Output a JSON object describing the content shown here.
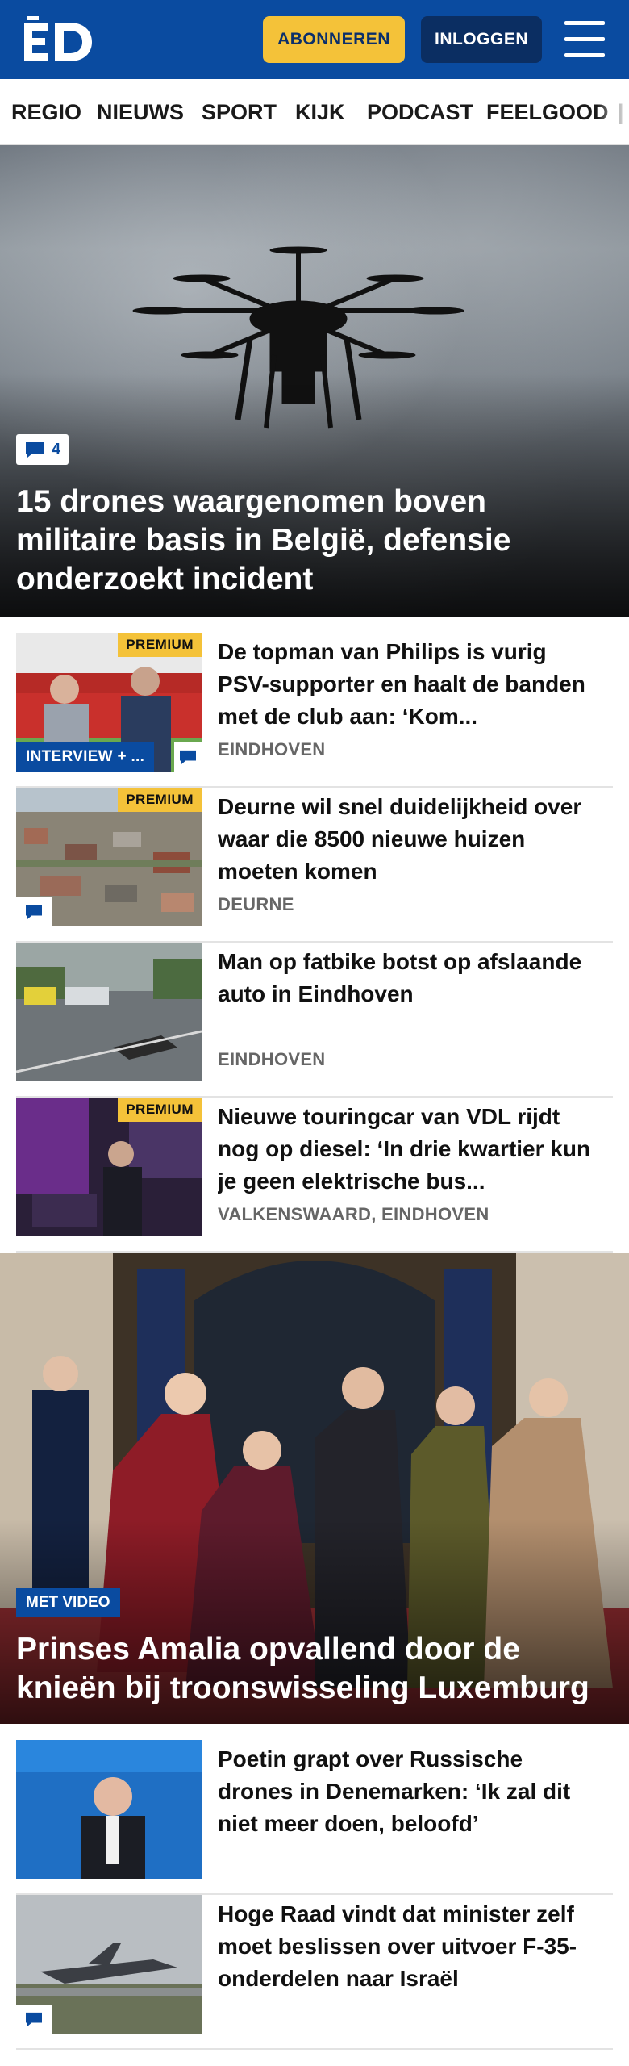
{
  "header": {
    "logo_text": "ED",
    "subscribe_label": "ABONNEREN",
    "login_label": "INLOGGEN"
  },
  "nav": {
    "items": [
      "REGIO",
      "NIEUWS",
      "SPORT",
      "KIJK",
      "PODCAST",
      "FEELGOOD"
    ]
  },
  "hero": {
    "comment_count": "4",
    "title": "15 drones waargenomen boven militaire basis in België, defensie onderzoekt incident"
  },
  "articles": [
    {
      "title": "De topman van Philips is vurig PSV-supporter en haalt de banden met de club aan: ‘Kom...",
      "location": "EINDHOVEN",
      "premium": "PREMIUM",
      "tag": "INTERVIEW + ..."
    },
    {
      "title": "Deurne wil snel duidelijkheid over waar die 8500 nieuwe huizen moeten komen",
      "location": "DEURNE",
      "premium": "PREMIUM"
    },
    {
      "title": "Man op fatbike botst op afslaande auto in Eindhoven",
      "location": "EINDHOVEN"
    },
    {
      "title": "Nieuwe touringcar van VDL rijdt nog op diesel: ‘In drie kwartier kun je geen elektrische bus...",
      "location": "VALKENSWAARD, EINDHOVEN",
      "premium": "PREMIUM"
    }
  ],
  "hero2": {
    "tag": "MET VIDEO",
    "title": "Prinses Amalia opvallend door de knieën bij troonswisseling Luxemburg"
  },
  "articles2": [
    {
      "title": "Poetin grapt over Russische drones in Denemarken: ‘Ik zal dit niet meer doen, beloofd’"
    },
    {
      "title": "Hoge Raad vindt dat minister zelf moet beslissen over uitvoer F-35-onderdelen naar Israël"
    }
  ],
  "colors": {
    "brand_blue": "#0a4ba0",
    "accent_yellow": "#f4c239",
    "dark_navy": "#0b2e62"
  }
}
